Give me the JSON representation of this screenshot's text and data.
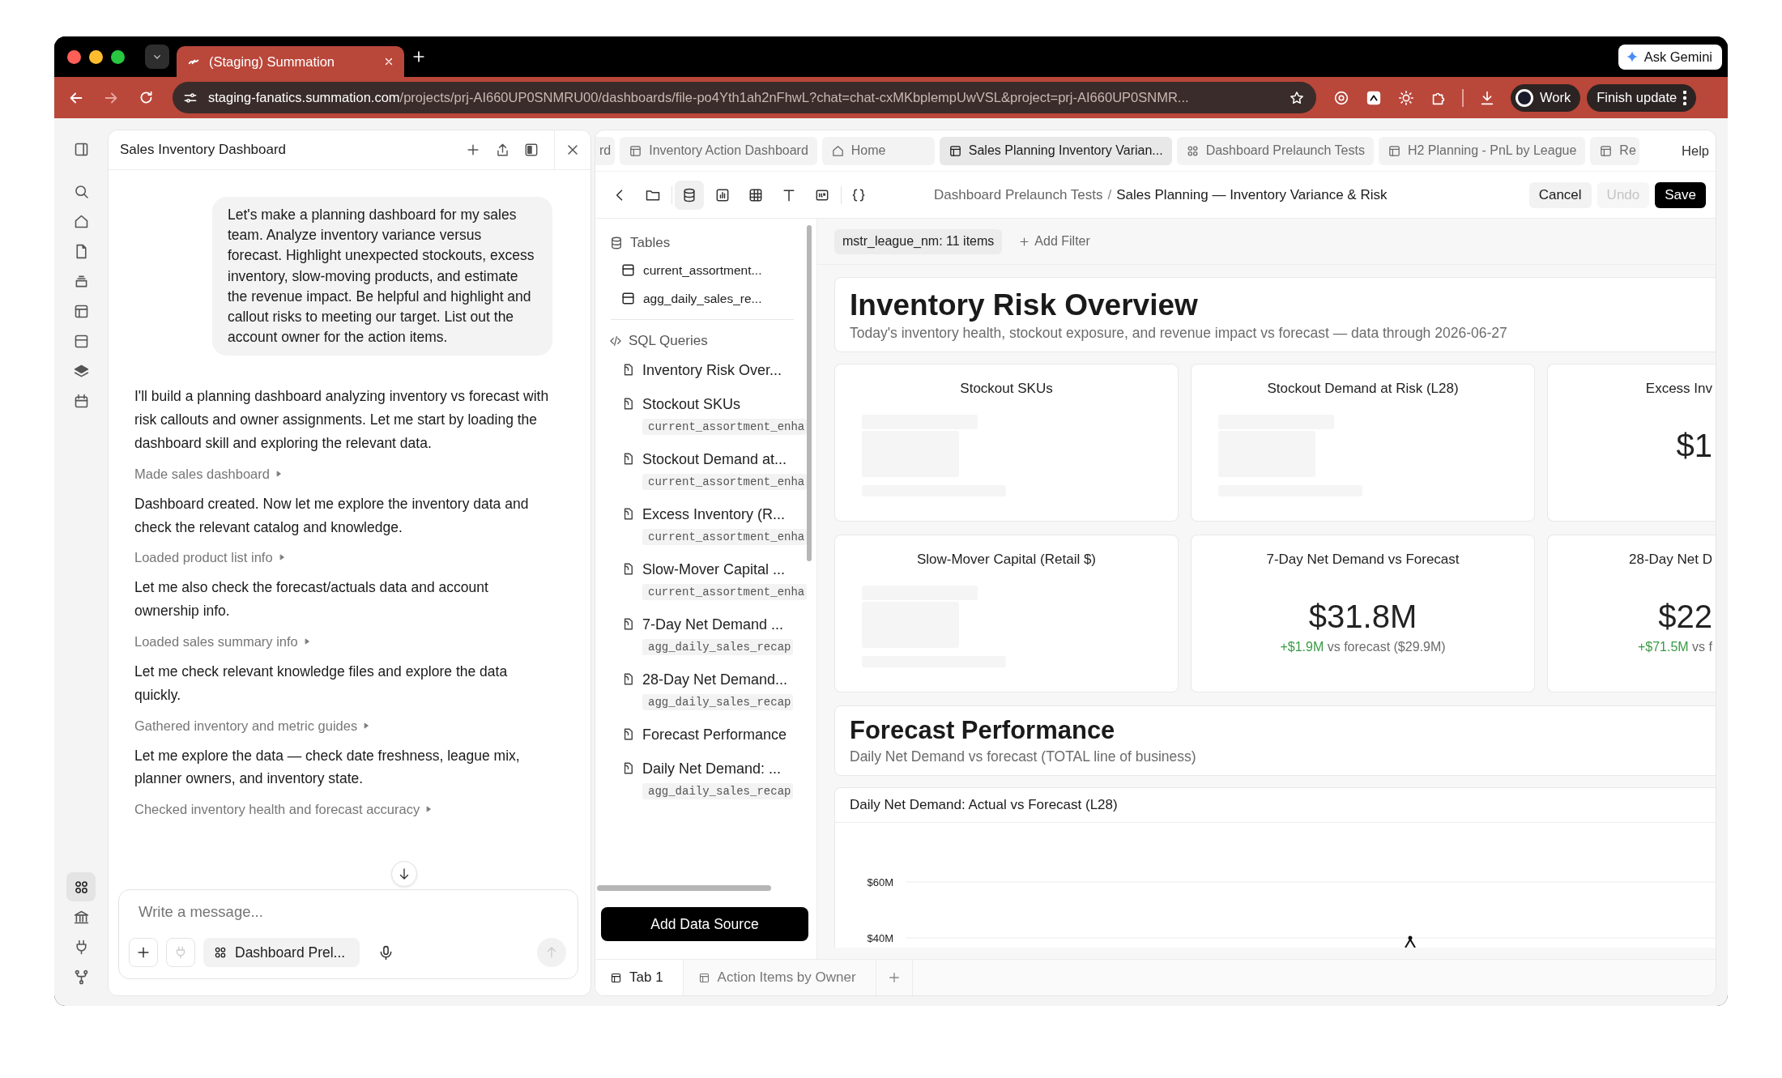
{
  "browser": {
    "tabs": [
      {
        "title": "(Staging) Summation",
        "selected": true
      }
    ],
    "gemini_button": "Ask Gemini",
    "url": {
      "host": "staging-fanatics.summation.com",
      "path": "/projects/prj-AI660UP0SNMRU00/dashboards/file-po4Yth1ah2nFhwL?chat=chat-cxMKbplempUwVSL&project=prj-AI660UP0SNMR..."
    },
    "profile": "Work",
    "update_button": "Finish update"
  },
  "rail": {
    "items": [
      {
        "selected": false
      },
      {
        "selected": false
      },
      {
        "selected": false
      },
      {
        "selected": false
      },
      {
        "selected": false
      },
      {
        "selected": false
      },
      {
        "selected": false
      },
      {
        "selected": false
      },
      {
        "selected": false
      },
      {
        "selected": true
      },
      {
        "selected": false
      },
      {
        "selected": false
      },
      {
        "selected": false
      }
    ]
  },
  "chat": {
    "title": "Sales Inventory Dashboard",
    "messages": [
      {
        "kind": "user",
        "text": "Let's make a planning dashboard for my sales team. Analyze inventory variance versus forecast. Highlight unexpected stockouts, excess inventory, slow-moving products, and estimate the revenue impact. Be helpful and highlight and callout risks to meeting our target. List out the account owner for the action items."
      },
      {
        "kind": "assistant",
        "text": "I'll build a planning dashboard analyzing inventory vs forecast with risk callouts and owner assignments. Let me start by loading the dashboard skill and exploring the relevant data."
      },
      {
        "kind": "step",
        "text": "Made sales dashboard"
      },
      {
        "kind": "assistant",
        "text": "Dashboard created. Now let me explore the inventory data and check the relevant catalog and knowledge."
      },
      {
        "kind": "step",
        "text": "Loaded product list info"
      },
      {
        "kind": "assistant",
        "text": "Let me also check the forecast/actuals data and account ownership info."
      },
      {
        "kind": "step",
        "text": "Loaded sales summary info"
      },
      {
        "kind": "assistant",
        "text": "Let me check relevant knowledge files and explore the data quickly."
      },
      {
        "kind": "step",
        "text": "Gathered inventory and metric guides"
      },
      {
        "kind": "assistant",
        "text": "Let me explore the data — check date freshness, league mix, planner owners, and inventory state."
      },
      {
        "kind": "step",
        "text": "Checked inventory health and forecast accuracy"
      }
    ],
    "composer": {
      "placeholder": "Write a message...",
      "context_chip": "Dashboard Prel..."
    }
  },
  "dashboard": {
    "tabs": [
      {
        "kind": "partial",
        "label": "rd",
        "selected": false
      },
      {
        "kind": "table",
        "label": "Inventory Action Dashboard",
        "selected": false
      },
      {
        "kind": "home",
        "label": "Home",
        "selected": false
      },
      {
        "kind": "table",
        "label": "Sales Planning Inventory Varian...",
        "selected": true
      },
      {
        "kind": "grid",
        "label": "Dashboard Prelaunch Tests",
        "selected": false
      },
      {
        "kind": "table",
        "label": "H2 Planning - PnL by League",
        "selected": false
      },
      {
        "kind": "table",
        "label": "Re",
        "selected": false
      }
    ],
    "help": "Help",
    "tools": [
      {
        "selected": false
      },
      {
        "selected": false
      },
      {
        "selected": true
      },
      {
        "selected": false
      },
      {
        "selected": false
      },
      {
        "selected": false
      },
      {
        "selected": false
      },
      {
        "selected": false
      }
    ],
    "breadcrumb": {
      "parent": "Dashboard Prelaunch Tests",
      "separator": "/",
      "current": "Sales Planning — Inventory Variance & Risk"
    },
    "actions": {
      "cancel": "Cancel",
      "undo": {
        "label": "Undo",
        "disabled": true
      },
      "save": "Save"
    },
    "sidebar": {
      "tables_heading": "Tables",
      "tables": [
        "current_assortment...",
        "agg_daily_sales_re..."
      ],
      "queries_heading": "SQL Queries",
      "queries": [
        {
          "title": "Inventory Risk Over..."
        },
        {
          "title": "Stockout SKUs",
          "source": "current_assortment_enha"
        },
        {
          "title": "Stockout Demand at...",
          "source": "current_assortment_enha"
        },
        {
          "title": "Excess Inventory (R...",
          "source": "current_assortment_enha"
        },
        {
          "title": "Slow-Mover Capital ...",
          "source": "current_assortment_enha"
        },
        {
          "title": "7-Day Net Demand ...",
          "source": "agg_daily_sales_recap"
        },
        {
          "title": "28-Day Net Demand...",
          "source": "agg_daily_sales_recap"
        },
        {
          "title": "Forecast Performance"
        },
        {
          "title": "Daily Net Demand: ...",
          "source": "agg_daily_sales_recap"
        }
      ],
      "add_button": "Add Data Source"
    },
    "filters": {
      "chip": "mstr_league_nm: 11 items",
      "add": "Add Filter"
    },
    "overview": {
      "title": "Inventory Risk Overview",
      "subtitle": "Today's inventory health, stockout exposure, and revenue impact vs forecast — data through 2026-06-27"
    },
    "kpis": [
      {
        "title": "Stockout SKUs",
        "loading": true
      },
      {
        "title": "Stockout Demand at Risk (L28)",
        "loading": true
      },
      {
        "title": "Excess Inv",
        "loading": false,
        "value": "$1"
      },
      {
        "title": "Slow-Mover Capital (Retail $)",
        "loading": true
      },
      {
        "title": "7-Day Net Demand vs Forecast",
        "loading": false,
        "value": "$31.8M",
        "delta": "+$1.9M",
        "comparison": "vs forecast ($29.9M)"
      },
      {
        "title": "28-Day Net D",
        "loading": false,
        "value": "$22",
        "delta": "+$71.5M",
        "comparison": "vs f"
      }
    ],
    "forecast": {
      "title": "Forecast Performance",
      "subtitle": "Daily Net Demand vs forecast (TOTAL line of business)"
    },
    "chart": {
      "title": "Daily Net Demand: Actual vs Forecast (L28)",
      "y_ticks": [
        "$60M",
        "$40M"
      ]
    },
    "page_tabs": [
      {
        "label": "Tab 1",
        "selected": true
      },
      {
        "label": "Action Items by Owner",
        "selected": false
      }
    ]
  }
}
